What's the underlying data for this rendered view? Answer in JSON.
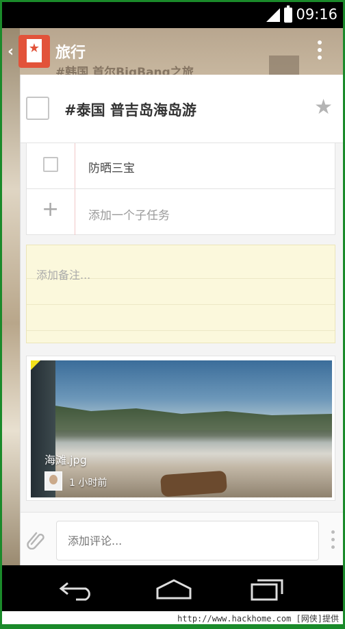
{
  "status_bar": {
    "time": "09:16"
  },
  "app_bar": {
    "back_glyph": "‹",
    "list_title": "旅行",
    "peek_row": "#韩国 首尔BigBang之旅"
  },
  "task": {
    "title": "#泰国 普吉岛海岛游",
    "starred": false
  },
  "subtasks": {
    "items": [
      {
        "label": "防晒三宝",
        "checked": false
      }
    ],
    "add_placeholder": "添加一个子任务"
  },
  "note": {
    "placeholder": "添加备注..."
  },
  "file": {
    "name": "海滩.jpg",
    "time_ago": "1 小时前"
  },
  "comment": {
    "placeholder": "添加评论..."
  },
  "footer": {
    "text": "http://www.hackhome.com [网侠]提供"
  },
  "colors": {
    "accent": "#e2533a",
    "note_bg": "#fbf8dc",
    "frame_border": "#1a8a2a"
  },
  "icons": [
    "signal-icon",
    "battery-icon",
    "back-chevron-icon",
    "wunderlist-logo-icon",
    "overflow-menu-icon",
    "star-icon",
    "plus-icon",
    "paperclip-icon",
    "nav-back-icon",
    "nav-home-icon",
    "nav-recent-icon"
  ]
}
